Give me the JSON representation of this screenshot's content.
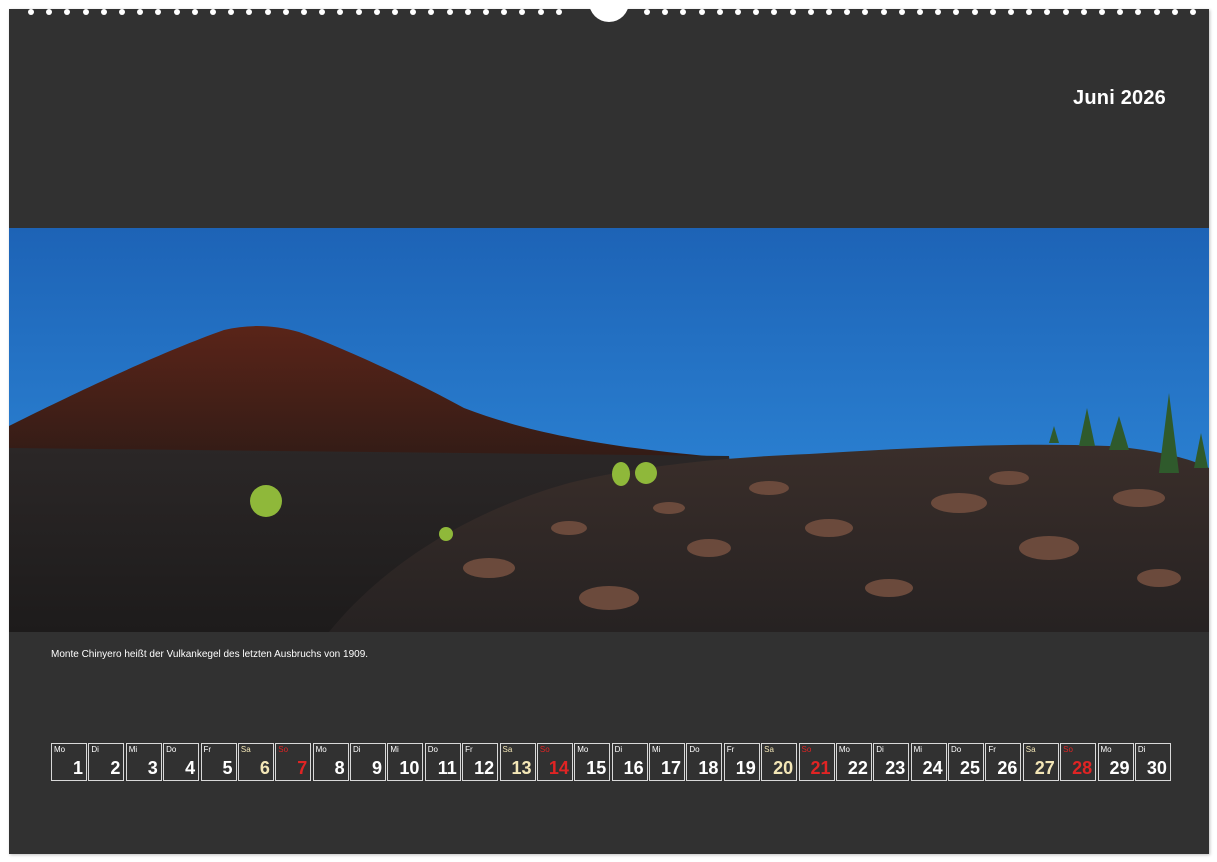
{
  "calendar": {
    "month_title": "Juni 2026",
    "caption": "Monte Chinyero heißt der Vulkankegel des letzten Ausbruchs von 1909.",
    "colors": {
      "background": "#313131",
      "weekday_text": "#ffffff",
      "saturday_text": "#f3e6b6",
      "sunday_text": "#e02424",
      "cell_border": "#d9d9d9"
    },
    "days": [
      {
        "wd": "Mo",
        "num": "1",
        "type": "weekday"
      },
      {
        "wd": "Di",
        "num": "2",
        "type": "weekday"
      },
      {
        "wd": "Mi",
        "num": "3",
        "type": "weekday"
      },
      {
        "wd": "Do",
        "num": "4",
        "type": "weekday"
      },
      {
        "wd": "Fr",
        "num": "5",
        "type": "weekday"
      },
      {
        "wd": "Sa",
        "num": "6",
        "type": "sat"
      },
      {
        "wd": "So",
        "num": "7",
        "type": "sun"
      },
      {
        "wd": "Mo",
        "num": "8",
        "type": "weekday"
      },
      {
        "wd": "Di",
        "num": "9",
        "type": "weekday"
      },
      {
        "wd": "Mi",
        "num": "10",
        "type": "weekday"
      },
      {
        "wd": "Do",
        "num": "11",
        "type": "weekday"
      },
      {
        "wd": "Fr",
        "num": "12",
        "type": "weekday"
      },
      {
        "wd": "Sa",
        "num": "13",
        "type": "sat"
      },
      {
        "wd": "So",
        "num": "14",
        "type": "sun"
      },
      {
        "wd": "Mo",
        "num": "15",
        "type": "weekday"
      },
      {
        "wd": "Di",
        "num": "16",
        "type": "weekday"
      },
      {
        "wd": "Mi",
        "num": "17",
        "type": "weekday"
      },
      {
        "wd": "Do",
        "num": "18",
        "type": "weekday"
      },
      {
        "wd": "Fr",
        "num": "19",
        "type": "weekday"
      },
      {
        "wd": "Sa",
        "num": "20",
        "type": "sat"
      },
      {
        "wd": "So",
        "num": "21",
        "type": "sun"
      },
      {
        "wd": "Mo",
        "num": "22",
        "type": "weekday"
      },
      {
        "wd": "Di",
        "num": "23",
        "type": "weekday"
      },
      {
        "wd": "Mi",
        "num": "24",
        "type": "weekday"
      },
      {
        "wd": "Do",
        "num": "25",
        "type": "weekday"
      },
      {
        "wd": "Fr",
        "num": "26",
        "type": "weekday"
      },
      {
        "wd": "Sa",
        "num": "27",
        "type": "sat"
      },
      {
        "wd": "So",
        "num": "28",
        "type": "sun"
      },
      {
        "wd": "Mo",
        "num": "29",
        "type": "weekday"
      },
      {
        "wd": "Di",
        "num": "30",
        "type": "weekday"
      }
    ]
  }
}
